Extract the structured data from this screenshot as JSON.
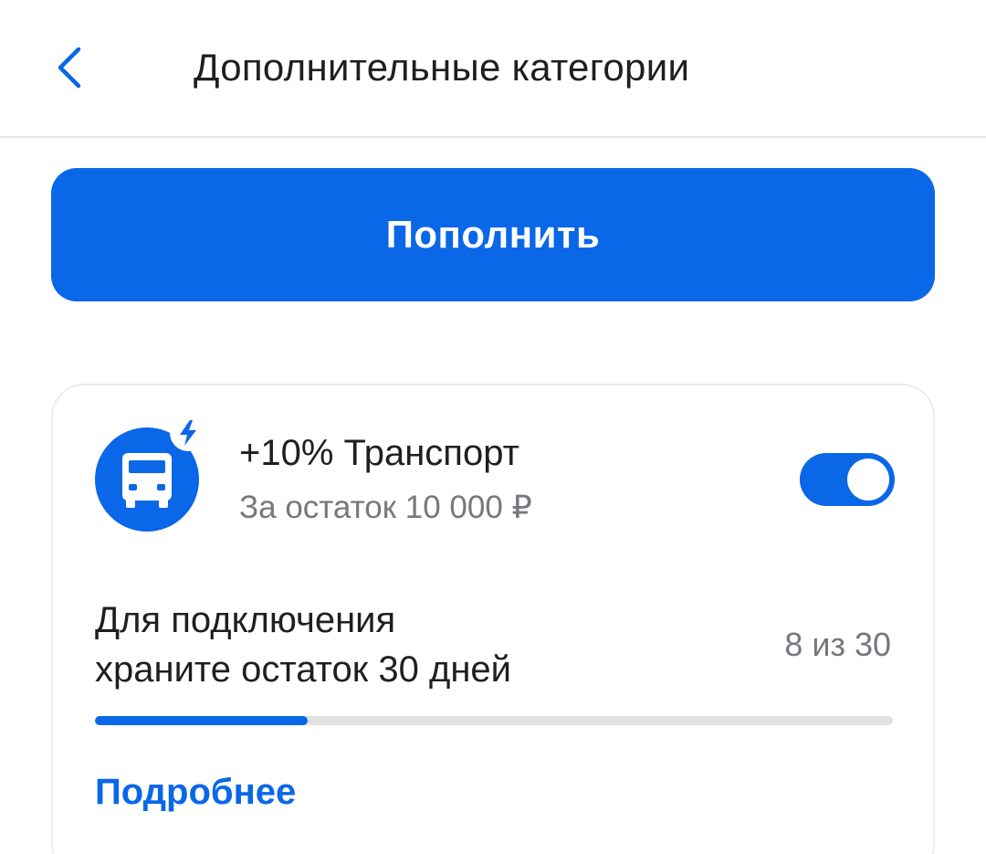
{
  "header": {
    "title": "Дополнительные категории",
    "back_icon": "chevron-left-icon"
  },
  "topup_button": {
    "label": "Пополнить"
  },
  "category_card": {
    "icon": "bus-icon",
    "badge_icon": "lightning-icon",
    "title": "+10% Транспорт",
    "subtitle": "За остаток 10 000 ₽",
    "toggle_on": true,
    "condition_line1": "Для подключения",
    "condition_line2": "храните остаток 30 дней",
    "progress_text": "8 из 30",
    "progress_current": 8,
    "progress_total": 30,
    "more_link": "Подробнее"
  },
  "colors": {
    "accent": "#0967e8",
    "text_primary": "#1f1f22",
    "text_secondary": "#77777d",
    "track": "#e1e1e4"
  }
}
